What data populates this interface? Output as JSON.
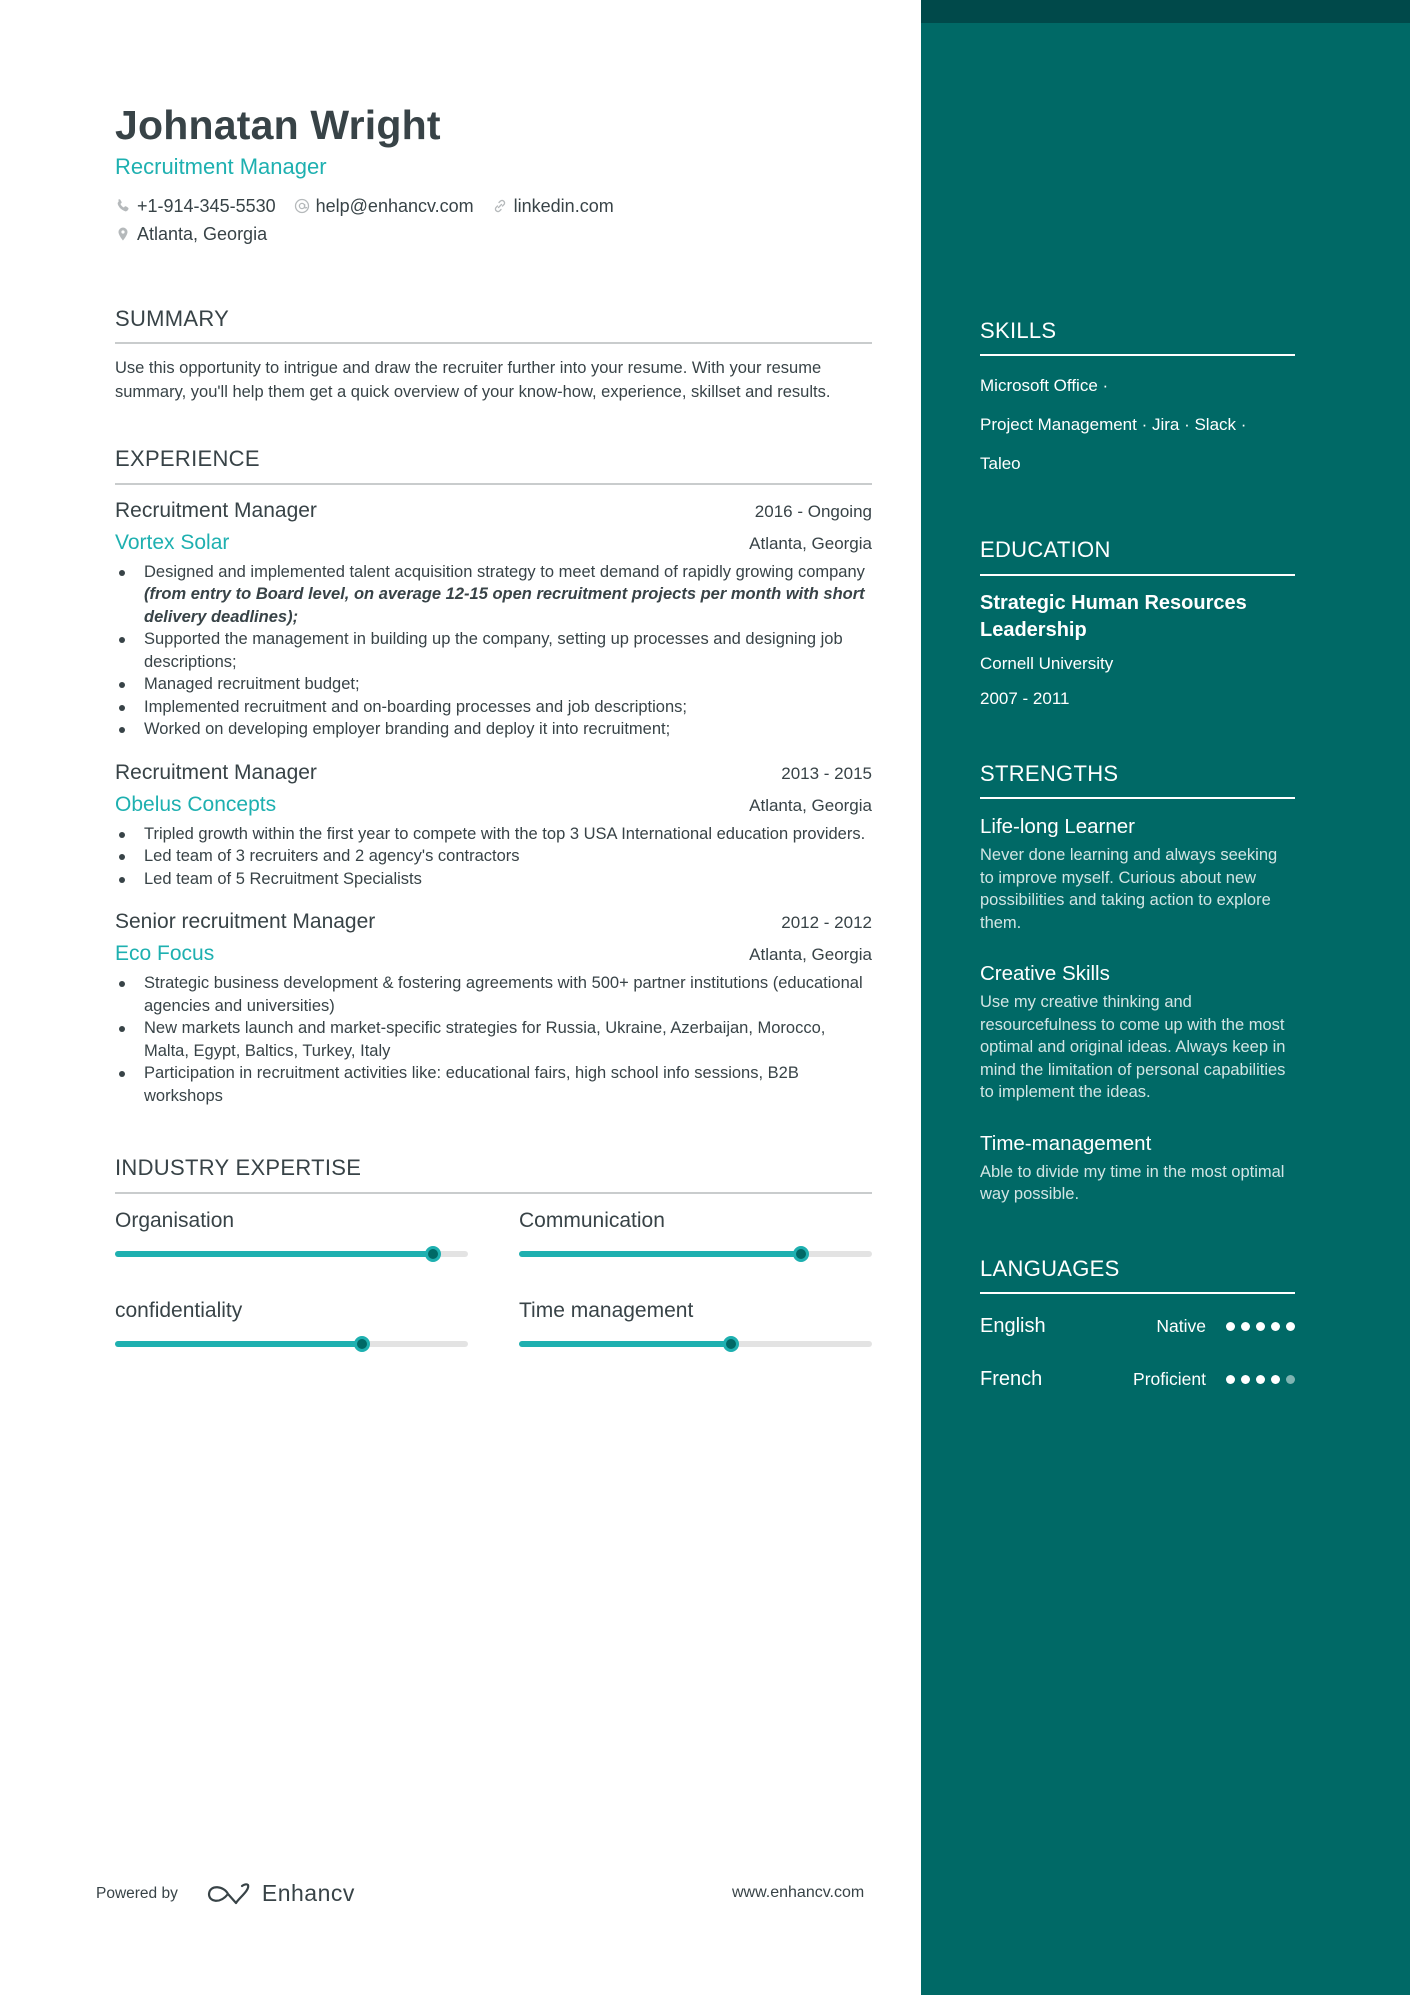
{
  "header": {
    "name": "Johnatan Wright",
    "title": "Recruitment Manager",
    "phone": "+1-914-345-5530",
    "email": "help@enhancv.com",
    "linkedin": "linkedin.com",
    "location": "Atlanta, Georgia",
    "icons": [
      "phone-icon",
      "at-icon",
      "link-icon",
      "location-pin-icon"
    ]
  },
  "summary": {
    "title": "SUMMARY",
    "text": "Use this opportunity to intrigue and draw the recruiter further into your resume. With your resume summary, you'll help them get a quick overview of your know-how, experience, skillset and results."
  },
  "experience": {
    "title": "EXPERIENCE",
    "jobs": [
      {
        "title": "Recruitment Manager",
        "dates": "2016 - Ongoing",
        "company": "Vortex Solar",
        "location": "Atlanta, Georgia",
        "bullets": [
          {
            "text": "Designed and implemented talent acquisition strategy to meet demand of rapidly growing company ",
            "emphasis": "(from entry to Board level, on average 12-15 open recruitment projects per month with short delivery deadlines);"
          },
          {
            "text": "Supported the management in building up the company, setting up processes and designing job descriptions;"
          },
          {
            "text": "Managed recruitment budget;"
          },
          {
            "text": "Implemented recruitment and on-boarding processes and job descriptions;"
          },
          {
            "text": "Worked on developing employer branding and deploy it into recruitment;"
          }
        ]
      },
      {
        "title": "Recruitment Manager",
        "dates": "2013 - 2015",
        "company": "Obelus Concepts",
        "location": "Atlanta, Georgia",
        "bullets": [
          {
            "text": "Tripled growth within the first year to compete with the top 3 USA International education providers."
          },
          {
            "text": "Led team of 3 recruiters and 2 agency's contractors"
          },
          {
            "text": "Led team of 5 Recruitment Specialists"
          }
        ]
      },
      {
        "title": "Senior recruitment Manager",
        "dates": "2012 - 2012",
        "company": "Eco Focus",
        "location": "Atlanta, Georgia",
        "bullets": [
          {
            "text": "Strategic business development & fostering agreements with 500+ partner institutions (educational agencies and universities)"
          },
          {
            "text": "New markets launch and market-specific strategies for Russia, Ukraine, Azerbaijan, Morocco, Malta, Egypt, Baltics, Turkey, Italy"
          },
          {
            "text": "Participation in recruitment activities like: educational fairs, high school info sessions, B2B workshops"
          }
        ]
      }
    ]
  },
  "expertise": {
    "title": "INDUSTRY EXPERTISE",
    "items": [
      {
        "label": "Organisation",
        "level": 0.9
      },
      {
        "label": "Communication",
        "level": 0.8
      },
      {
        "label": "confidentiality",
        "level": 0.7
      },
      {
        "label": "Time management",
        "level": 0.6
      }
    ]
  },
  "sidebar": {
    "skills": {
      "title": "SKILLS",
      "lines": [
        "Microsoft Office ·",
        "Project Management · Jira · Slack ·",
        "Taleo"
      ]
    },
    "education": {
      "title": "EDUCATION",
      "degree": "Strategic Human Resources Leadership",
      "school": "Cornell University",
      "dates": "2007 - 2011"
    },
    "strengths": {
      "title": "STRENGTHS",
      "items": [
        {
          "title": "Life-long Learner",
          "description": "Never done learning and always seeking to improve myself. Curious about new possibilities and taking action to explore them."
        },
        {
          "title": "Creative Skills",
          "description": "Use my creative thinking and resourcefulness to come up with the most optimal and original ideas. Always keep in mind the limitation of personal capabilities to implement the ideas."
        },
        {
          "title": "Time-management",
          "description": "Able to divide my time in the most optimal way possible."
        }
      ]
    },
    "languages": {
      "title": "LANGUAGES",
      "items": [
        {
          "name": "English",
          "level": "Native",
          "rating": 5,
          "max": 5
        },
        {
          "name": "French",
          "level": "Proficient",
          "rating": 4,
          "max": 5
        }
      ]
    }
  },
  "footer": {
    "powered_by": "Powered by",
    "brand": "Enhancv",
    "website": "www.enhancv.com"
  },
  "colors": {
    "accent": "#1eb0b0",
    "sidebar": "#006966",
    "sidebar_top": "#00494a",
    "text": "#384347"
  }
}
